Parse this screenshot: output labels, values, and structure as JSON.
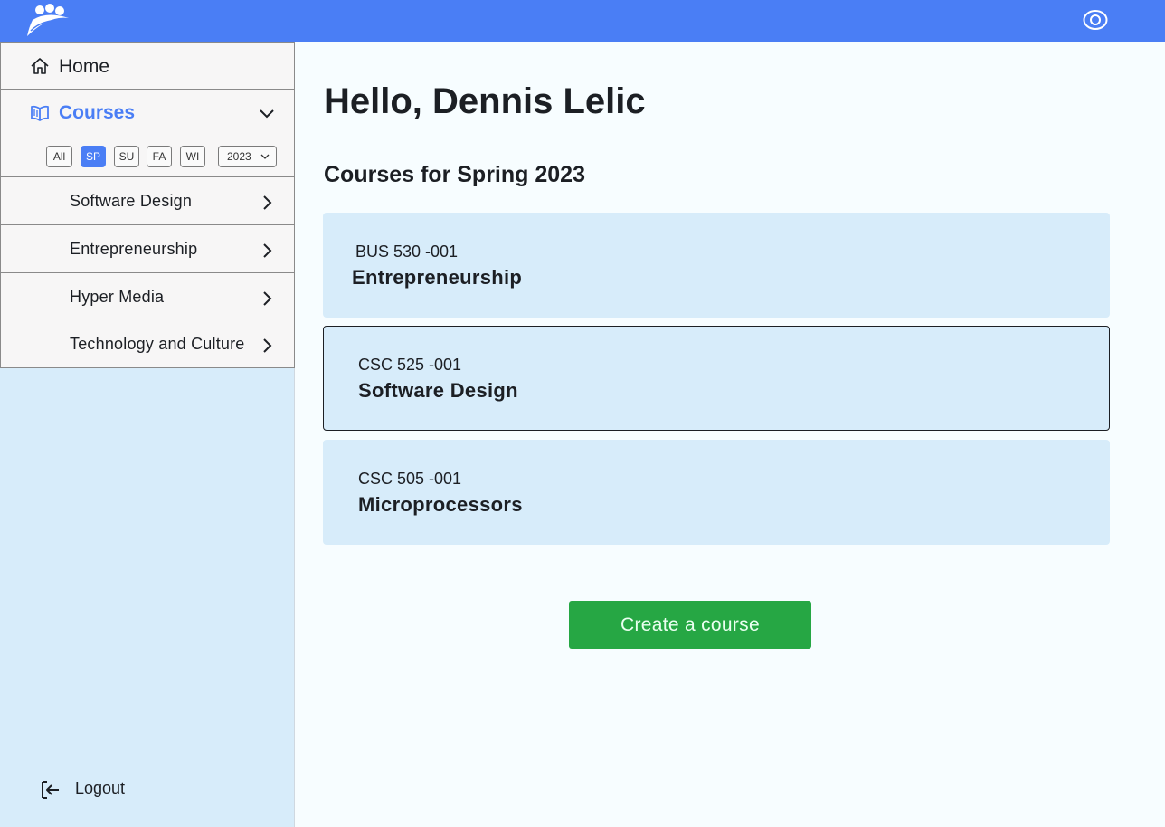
{
  "header": {
    "logo_icon": "people-logo-icon",
    "view_icon": "eye-icon",
    "color": "#4a7ef5"
  },
  "sidebar": {
    "home": {
      "icon": "home-icon",
      "label": "Home"
    },
    "courses": {
      "icon": "open-book-icon",
      "label": "Courses",
      "expand_icon": "chevron-down-icon",
      "semester_filters": [
        {
          "label": "All",
          "active": false
        },
        {
          "label": "SP",
          "active": true
        },
        {
          "label": "SU",
          "active": false
        },
        {
          "label": "FA",
          "active": false
        },
        {
          "label": "WI",
          "active": false
        }
      ],
      "year": "2023",
      "items": [
        {
          "label": "Software Design",
          "icon": "chevron-right-icon"
        },
        {
          "label": "Entrepreneurship",
          "icon": "chevron-right-icon"
        },
        {
          "label": "Hyper Media",
          "icon": "chevron-right-icon"
        },
        {
          "label": "Technology and Culture",
          "icon": "chevron-right-icon"
        }
      ]
    },
    "logout": {
      "icon": "logout-icon",
      "label": "Logout"
    }
  },
  "main": {
    "greeting": "Hello, Dennis Lelic",
    "subheading": "Courses for Spring 2023",
    "cards": [
      {
        "code": "BUS 530 -001",
        "title": "Entrepreneurship",
        "selected": false
      },
      {
        "code": "CSC 525 -001",
        "title": "Software Design",
        "selected": true
      },
      {
        "code": "CSC 505 -001",
        "title": "Microprocessors",
        "selected": false
      }
    ],
    "create_button": "Create a course"
  },
  "colors": {
    "accent": "#4a7ef5",
    "sidebar_bg": "#d7ecfa",
    "card_bg": "#d7ecfa",
    "button": "#26a744"
  }
}
